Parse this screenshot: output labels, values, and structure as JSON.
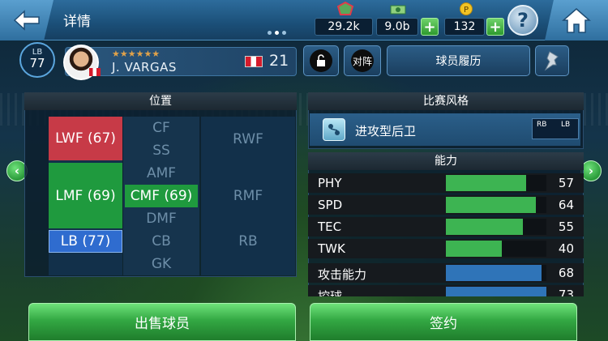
{
  "header": {
    "title": "详情",
    "page_dots": 3,
    "active_dot": 1
  },
  "currency": {
    "gp": "29.2k",
    "money": "9.0b",
    "coins": "132"
  },
  "player": {
    "position_badge_top": "LB",
    "position_badge_value": "77",
    "stars": "★★★★★★",
    "name": "J. VARGAS",
    "jersey_number": "21"
  },
  "buttons": {
    "match": "对阵",
    "history": "球员履历",
    "sell": "出售球员",
    "sign": "签约"
  },
  "position_panel": {
    "title": "位置",
    "cells": {
      "cf": "CF",
      "ss": "SS",
      "amf": "AMF",
      "dmf": "DMF",
      "cb": "CB",
      "gk": "GK",
      "rwf": "RWF",
      "rmf": "RMF",
      "rb": "RB",
      "lwf": "LWF (67)",
      "lmf": "LMF (69)",
      "cmf": "CMF (69)",
      "lb": "LB (77)"
    }
  },
  "style_panel": {
    "title": "比赛风格",
    "style_name": "进攻型后卫",
    "tag1": "RB",
    "tag2": "LB"
  },
  "ability_panel": {
    "title": "能力",
    "rows": [
      {
        "label": "PHY",
        "value": "57",
        "fill": 0.57,
        "color": "#3db452"
      },
      {
        "label": "SPD",
        "value": "64",
        "fill": 0.64,
        "color": "#3db452"
      },
      {
        "label": "TEC",
        "value": "55",
        "fill": 0.55,
        "color": "#3db452"
      },
      {
        "label": "TWK",
        "value": "40",
        "fill": 0.4,
        "color": "#3db452"
      },
      {
        "label": "攻击能力",
        "value": "68",
        "fill": 0.68,
        "color": "#2f74b8"
      },
      {
        "label": "控球",
        "value": "73",
        "fill": 0.73,
        "color": "#2f74b8"
      }
    ]
  },
  "colors": {
    "lwf_red": "#c73a47",
    "lmf_green": "#1f9a3e",
    "lb_blue": "#2f6ccf",
    "cmf_green": "#1f9a3e"
  }
}
